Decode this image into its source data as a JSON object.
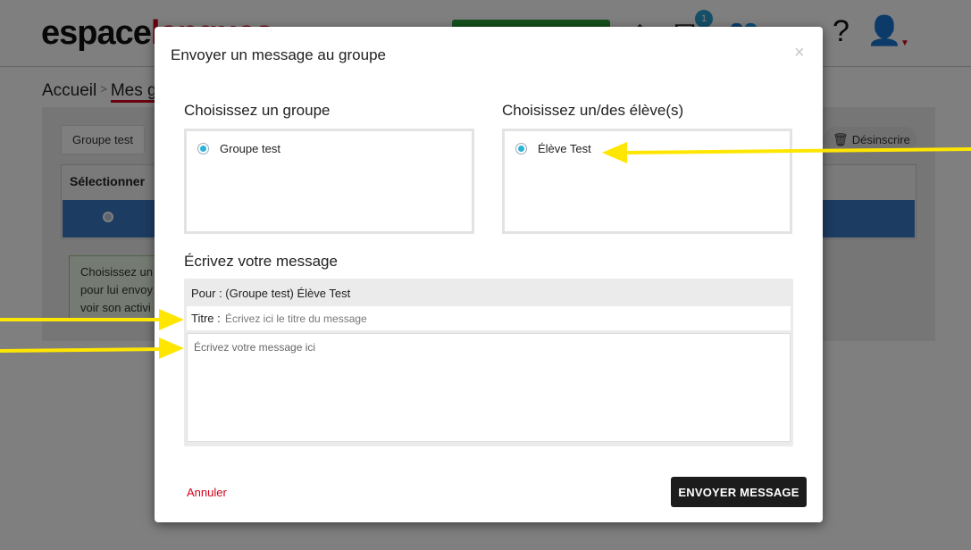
{
  "background": {
    "logo_main": "espace",
    "logo_accent": "langues",
    "notification_count": "1",
    "breadcrumb": {
      "home": "Accueil",
      "separator": ">",
      "current": "Mes g"
    },
    "group_tab": "Groupe test",
    "unsubscribe_label": "Désinscrire",
    "table_header": "Sélectionner",
    "info_lines": [
      "Choisissez un",
      "pour lui envoy",
      "voir son activi"
    ]
  },
  "modal": {
    "title": "Envoyer un message au groupe",
    "close_glyph": "×",
    "group_section": {
      "label": "Choisissez un groupe",
      "options": [
        {
          "label": "Groupe test",
          "selected": true
        }
      ]
    },
    "student_section": {
      "label": "Choisissez un/des élève(s)",
      "options": [
        {
          "label": "Élève Test",
          "selected": true
        }
      ]
    },
    "message_section": {
      "label": "Écrivez votre message",
      "recipient_line": "Pour : (Groupe test) Élève Test",
      "title_label": "Titre :",
      "title_placeholder": "Écrivez ici le titre du message",
      "body_placeholder": "Écrivez votre message ici"
    },
    "cancel_label": "Annuler",
    "send_label": "ENVOYER MESSAGE"
  },
  "colors": {
    "accent_red": "#d0021b",
    "radio_blue": "#2bb3d8",
    "annotation_yellow": "#ffe600",
    "send_button": "#1c1c1c"
  }
}
